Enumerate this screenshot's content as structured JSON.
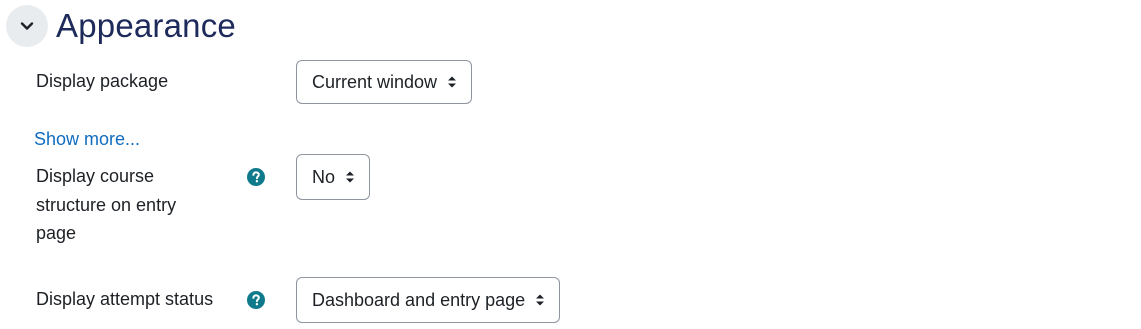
{
  "section": {
    "title": "Appearance",
    "collapse_icon": "chevron-down-icon"
  },
  "fields": {
    "display_package": {
      "label": "Display package",
      "value": "Current window"
    },
    "show_more": "Show more...",
    "course_structure": {
      "label_line1": "Display course",
      "label_line2": "structure on entry",
      "label_line3": "page",
      "value": "No",
      "help_icon": "question-circle-icon"
    },
    "attempt_status": {
      "label": "Display attempt status",
      "value": "Dashboard and entry page",
      "help_icon": "question-circle-icon"
    }
  },
  "colors": {
    "title": "#1d2a5a",
    "link": "#0f6cbf",
    "help_icon": "#0f7a8c",
    "toggle_bg": "#e9ecef",
    "select_border": "#8f959e"
  }
}
